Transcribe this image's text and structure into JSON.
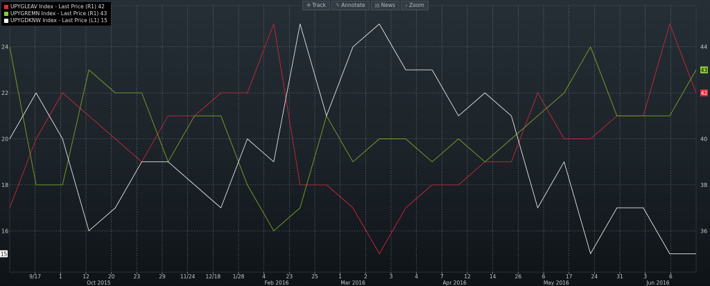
{
  "toolbar": {
    "track": "Track",
    "annotate": "Annotate",
    "news": "News",
    "zoom": "Zoom"
  },
  "legend": [
    {
      "label": "UPYGLEAV Index - Last Price (R1) 42",
      "color": "#e8253a"
    },
    {
      "label": "UPYGREMN Index - Last Price (R1) 43",
      "color": "#8dc63f"
    },
    {
      "label": "UPYGDKNW Index - Last Price (L1) 15",
      "color": "#ffffff"
    }
  ],
  "chart_data": {
    "type": "line",
    "x_ticks": [
      "9/17",
      "1",
      "12",
      "20",
      "23",
      "29",
      "11/24",
      "12/18",
      "1/28",
      "4",
      "23",
      "25",
      "1",
      "2",
      "3",
      "4",
      "7",
      "12",
      "14",
      "26",
      "6",
      "17",
      "24",
      "31",
      "3",
      "6"
    ],
    "x_month_labels": [
      "Oct 2015",
      "Feb 2016",
      "Mar 2016",
      "Apr 2016",
      "May 2016",
      "Jun 2016"
    ],
    "left_axis": {
      "ticks": [
        16,
        18,
        20,
        22,
        24
      ],
      "ylim": [
        14.2,
        25.8
      ]
    },
    "right_axis": {
      "ticks": [
        36,
        38,
        40,
        42,
        44
      ],
      "ylim": [
        34.2,
        45.8
      ]
    },
    "grid": true,
    "series": [
      {
        "name": "UPYGLEAV Index - Last Price (R1)",
        "axis": "right",
        "color": "#c8283e",
        "last_value": "42",
        "values": [
          37,
          40,
          42,
          41,
          40,
          39,
          41,
          41,
          42,
          42,
          45,
          38,
          38,
          37,
          35,
          37,
          38,
          38,
          39,
          39,
          42,
          40,
          40,
          41,
          41,
          45,
          42
        ]
      },
      {
        "name": "UPYGREMN Index - Last Price (R1)",
        "axis": "right",
        "color": "#7fa52a",
        "last_value": "43",
        "values": [
          44,
          38,
          38,
          43,
          42,
          42,
          39,
          41,
          41,
          38,
          36,
          37,
          41,
          39,
          40,
          40,
          39,
          40,
          39,
          40,
          41,
          42,
          44,
          41,
          41,
          41,
          43
        ]
      },
      {
        "name": "UPYGDKNW Index - Last Price (L1)",
        "axis": "left",
        "color": "#e6e6e6",
        "last_value": "15",
        "values": [
          20,
          22,
          20,
          16,
          17,
          19,
          19,
          18,
          17,
          20,
          19,
          25,
          21,
          24,
          25,
          23,
          23,
          21,
          22,
          21,
          17,
          19,
          15,
          17,
          17,
          15,
          15
        ]
      }
    ]
  }
}
